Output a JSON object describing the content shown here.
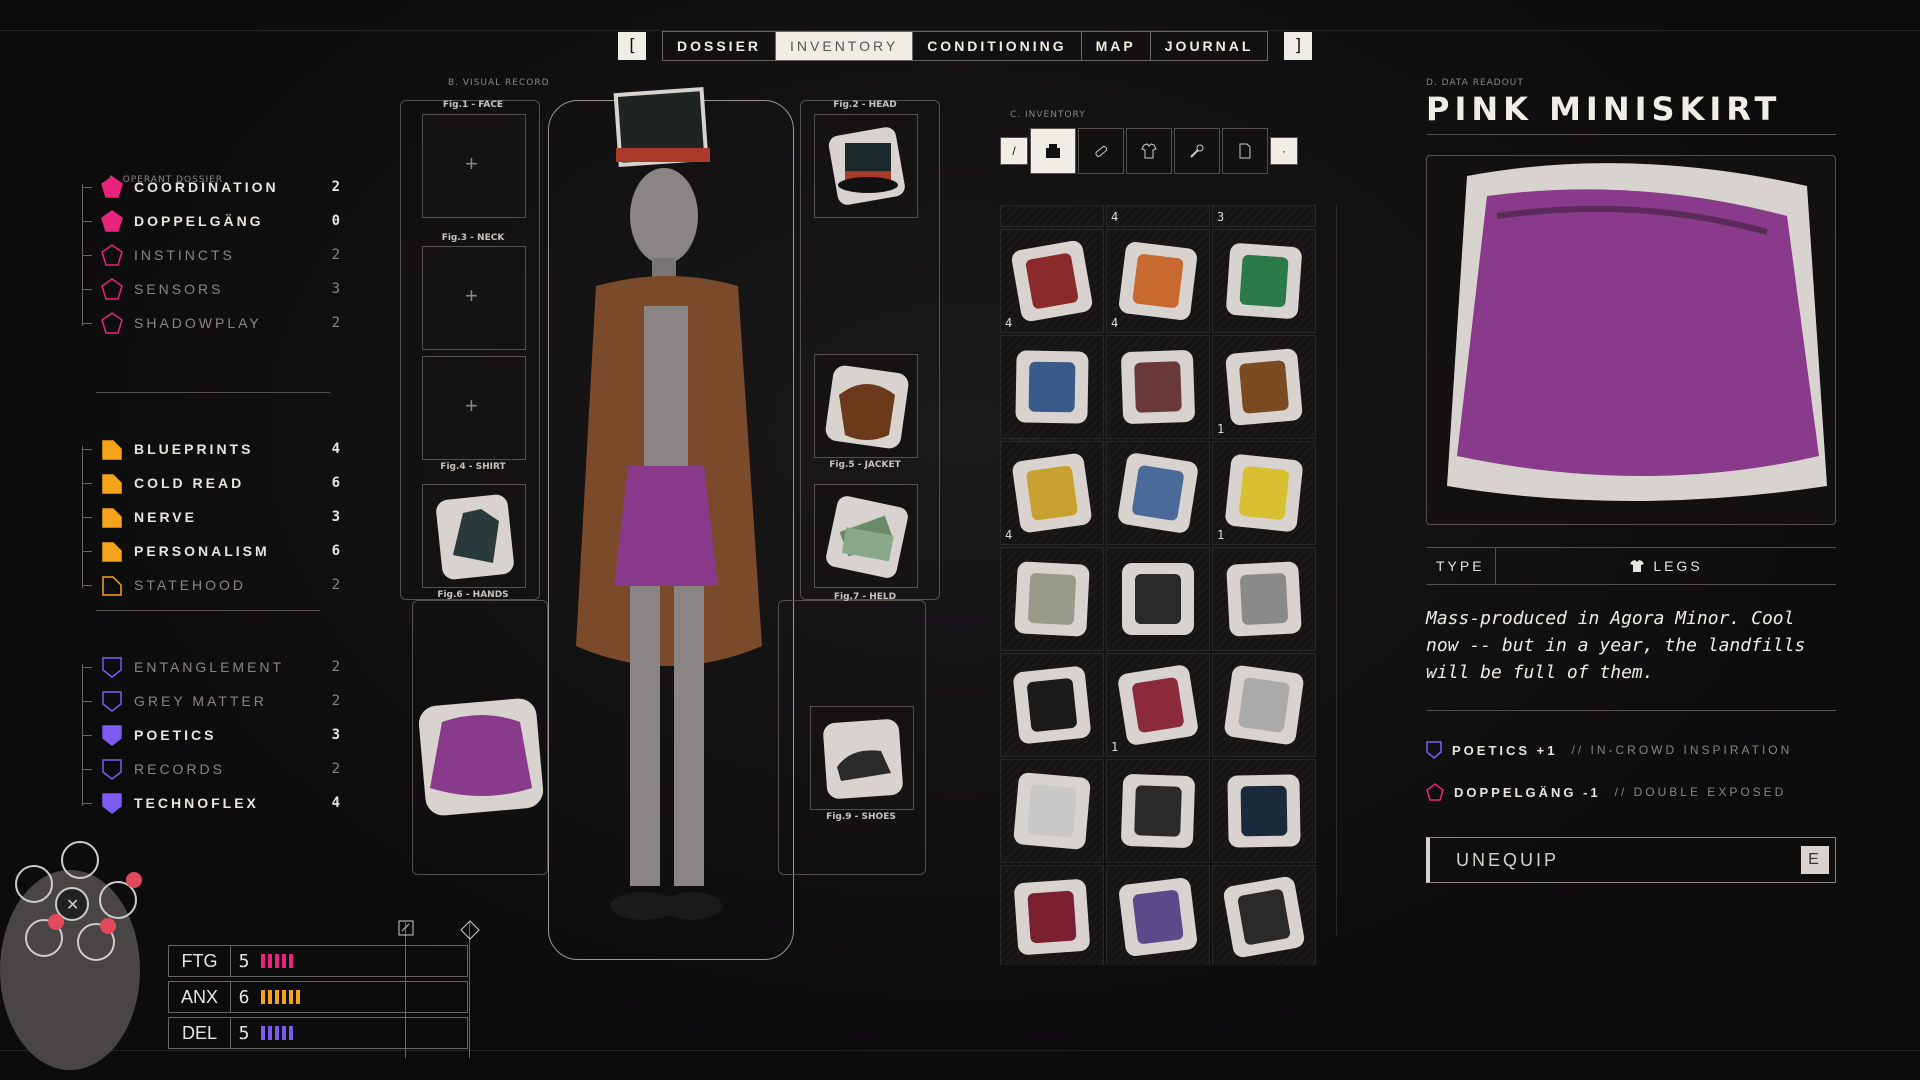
{
  "nav": {
    "left_bracket": "[",
    "right_bracket": "]",
    "tabs": [
      {
        "label": "DOSSIER"
      },
      {
        "label": "INVENTORY",
        "active": true
      },
      {
        "label": "CONDITIONING"
      },
      {
        "label": "MAP"
      },
      {
        "label": "JOURNAL"
      }
    ]
  },
  "sections": {
    "dossier": "A. OPERANT DOSSIER",
    "visual": "B. VISUAL RECORD",
    "inventory": "C. INVENTORY",
    "readout": "D. DATA READOUT"
  },
  "dossier": {
    "groups": [
      {
        "shape": "pentagon",
        "color": "#e8257a",
        "stats": [
          {
            "name": "COORDINATION",
            "value": "2",
            "filled": true
          },
          {
            "name": "DOPPELGÄNG",
            "value": "0",
            "filled": true
          },
          {
            "name": "INSTINCTS",
            "value": "2",
            "filled": false
          },
          {
            "name": "SENSORS",
            "value": "3",
            "filled": false
          },
          {
            "name": "SHADOWPLAY",
            "value": "2",
            "filled": false
          }
        ]
      },
      {
        "shape": "folder",
        "color": "#f5a31a",
        "stats": [
          {
            "name": "BLUEPRINTS",
            "value": "4",
            "filled": true
          },
          {
            "name": "COLD READ",
            "value": "6",
            "filled": true
          },
          {
            "name": "NERVE",
            "value": "3",
            "filled": true
          },
          {
            "name": "PERSONALISM",
            "value": "6",
            "filled": true
          },
          {
            "name": "STATEHOOD",
            "value": "2",
            "filled": false
          }
        ]
      },
      {
        "shape": "shield",
        "color": "#7a5cf0",
        "stats": [
          {
            "name": "ENTANGLEMENT",
            "value": "2",
            "filled": false
          },
          {
            "name": "GREY MATTER",
            "value": "2",
            "filled": false
          },
          {
            "name": "POETICS",
            "value": "3",
            "filled": true
          },
          {
            "name": "RECORDS",
            "value": "2",
            "filled": false
          },
          {
            "name": "TECHNOFLEX",
            "value": "4",
            "filled": true
          }
        ]
      }
    ]
  },
  "status": [
    {
      "label": "FTG",
      "value": "5",
      "pips": 5,
      "color": "#e8257a"
    },
    {
      "label": "ANX",
      "value": "6",
      "pips": 6,
      "color": "#f5a31a"
    },
    {
      "label": "DEL",
      "value": "5",
      "pips": 5,
      "color": "#7a5cf0"
    }
  ],
  "slots": {
    "face": "Fig.1 - FACE",
    "head": "Fig.2 - HEAD",
    "neck": "Fig.3 - NECK",
    "shirt": "Fig.4 - SHIRT",
    "jacket": "Fig.5 - JACKET",
    "hands": "Fig.6 - HANDS",
    "held": "Fig.7 - HELD",
    "shoes": "Fig.9 - SHOES"
  },
  "inventory": {
    "top_counts": [
      "",
      "4",
      "3"
    ],
    "items": [
      {
        "icon": "soda-can-icon",
        "count": "4",
        "color": "#8a2a2a"
      },
      {
        "icon": "cigarette-pack-icon",
        "count": "4",
        "color": "#c86a30"
      },
      {
        "icon": "magazine-icon",
        "count": "",
        "color": "#2a7a4a"
      },
      {
        "icon": "comic-book-icon",
        "count": "",
        "color": "#3a5a8a"
      },
      {
        "icon": "poster-icon",
        "count": "",
        "color": "#6a3a3a"
      },
      {
        "icon": "beer-bottle-icon",
        "count": "1",
        "color": "#7a4a20"
      },
      {
        "icon": "energy-can-icon",
        "count": "4",
        "color": "#c8a030"
      },
      {
        "icon": "helmet-icon",
        "count": "",
        "color": "#4a6a9a"
      },
      {
        "icon": "snack-bag-icon",
        "count": "1",
        "color": "#d8c030"
      },
      {
        "icon": "passport-icon",
        "count": "",
        "color": "#9a9a8a"
      },
      {
        "icon": "cap-icon",
        "count": "",
        "color": "#2a2a2a"
      },
      {
        "icon": "newspaper-icon",
        "count": "",
        "color": "#8a8a8a"
      },
      {
        "icon": "glasses-icon",
        "count": "",
        "color": "#1a1a1a"
      },
      {
        "icon": "book-icon",
        "count": "1",
        "color": "#8a2a3a"
      },
      {
        "icon": "necklace-icon",
        "count": "",
        "color": "#aaaaaa"
      },
      {
        "icon": "sneakers-icon",
        "count": "",
        "color": "#c8c8c8"
      },
      {
        "icon": "gloves-icon",
        "count": "",
        "color": "#2a2a2a"
      },
      {
        "icon": "gloves-icon",
        "count": "",
        "color": "#1a2a3a"
      },
      {
        "icon": "shorts-icon",
        "count": "",
        "color": "#7a2030"
      },
      {
        "icon": "bouquet-icon",
        "count": "",
        "color": "#5a4a8a"
      },
      {
        "icon": "pants-icon",
        "count": "",
        "color": "#2a2a2a"
      }
    ]
  },
  "readout": {
    "title": "PINK MINISKIRT",
    "type_label": "TYPE",
    "type_value": "LEGS",
    "description": "Mass-produced in Agora Minor. Cool now -- but in a year, the landfills will be full of them.",
    "effects": [
      {
        "icon": "shield-icon",
        "color": "#7a5cf0",
        "name": "POETICS +1",
        "note": "// IN-CROWD INSPIRATION"
      },
      {
        "icon": "pentagon-icon",
        "color": "#e8257a",
        "name": "DOPPELGÄNG -1",
        "note": "// DOUBLE EXPOSED"
      }
    ],
    "button": "UNEQUIP",
    "button_key": "E"
  }
}
